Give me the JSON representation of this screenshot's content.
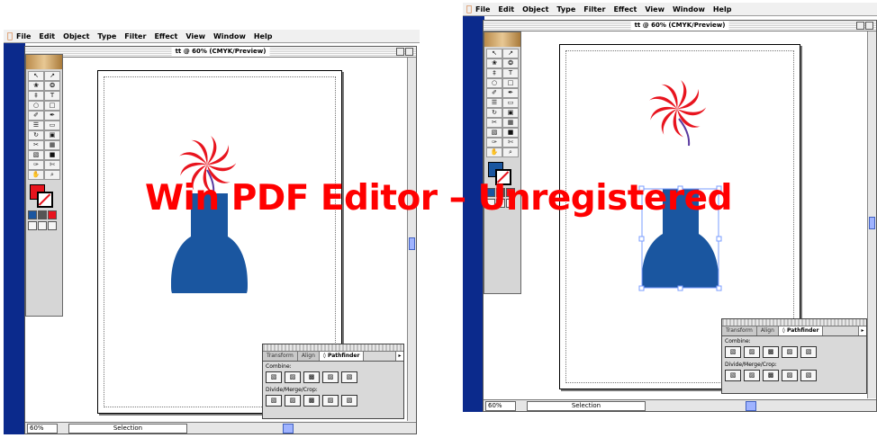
{
  "watermark": "Win PDF Editor – Unregistered",
  "menu": [
    "File",
    "Edit",
    "Object",
    "Type",
    "Filter",
    "Effect",
    "View",
    "Window",
    "Help"
  ],
  "window_title": "tt @ 60% (CMYK/Preview)",
  "tools": [
    "↖",
    "↗",
    "❀",
    "❂",
    "‡",
    "T",
    "○",
    "□",
    "✐",
    "✒",
    "☰",
    "▭",
    "↻",
    "▣",
    "✂",
    "▦",
    "▧",
    "■",
    "✑",
    "✄",
    "✋",
    "⌕"
  ],
  "status": {
    "zoom": "60%",
    "tool": "Selection"
  },
  "pathfinder": {
    "tabs": [
      "Transform",
      "Align",
      "◊ Pathfinder"
    ],
    "combine_label": "Combine:",
    "divide_label": "Divide/Merge/Crop:",
    "icons": [
      "▧",
      "▨",
      "▩",
      "▨",
      "▧"
    ]
  },
  "colors": {
    "fill": "#e8141e",
    "shape": "#1a56a0",
    "selection": "#7a9cff",
    "desktop": "#0b2a8c"
  }
}
